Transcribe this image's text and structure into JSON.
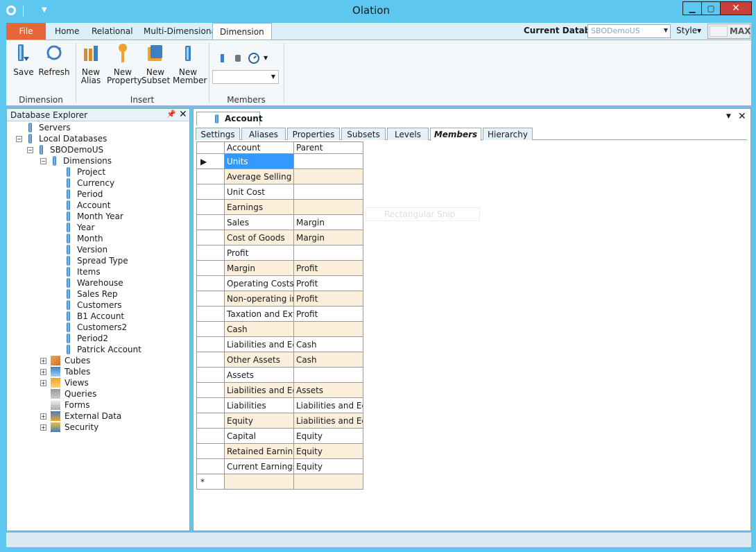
{
  "window": {
    "title": "Olation"
  },
  "ribbon_tabs": [
    "File",
    "Home",
    "Relational",
    "Multi-Dimensional",
    "Dimension"
  ],
  "current_db": {
    "label": "Current Database:",
    "value": "SBODemoUS"
  },
  "style": {
    "label": "Style",
    "max_label": "MAX"
  },
  "ribbon": {
    "save": "Save",
    "refresh": "Refresh",
    "dimension_group": "Dimension",
    "new_alias": [
      "New",
      "Alias"
    ],
    "new_property": [
      "New",
      "Property"
    ],
    "new_subset": [
      "New",
      "Subset"
    ],
    "new_member": [
      "New",
      "Member"
    ],
    "insert_group": "Insert",
    "members_group": "Members"
  },
  "explorer": {
    "title": "Database Explorer",
    "servers": "Servers",
    "local_databases": "Local Databases",
    "database": "SBODemoUS",
    "dimensions_label": "Dimensions",
    "dimensions": [
      "Project",
      "Currency",
      "Period",
      "Account",
      "Month Year",
      "Year",
      "Month",
      "Version",
      "Spread Type",
      "Items",
      "Warehouse",
      "Sales Rep",
      "Customers",
      "B1 Account",
      "Customers2",
      "Period2",
      "Patrick Account"
    ],
    "other": [
      "Cubes",
      "Tables",
      "Views",
      "Queries",
      "Forms",
      "External Data",
      "Security"
    ]
  },
  "document": {
    "tab": "Account",
    "subtabs": [
      "Settings",
      "Aliases",
      "Properties",
      "Subsets",
      "Levels",
      "Members",
      "Hierarchy"
    ],
    "columns": [
      "Account",
      "Parent"
    ],
    "rows": [
      [
        "Units",
        ""
      ],
      [
        "Average Selling ...",
        ""
      ],
      [
        "Unit Cost",
        ""
      ],
      [
        "Earnings",
        ""
      ],
      [
        "Sales",
        "Margin"
      ],
      [
        "Cost of Goods",
        "Margin"
      ],
      [
        "Profit",
        ""
      ],
      [
        "Margin",
        "Profit"
      ],
      [
        "Operating Costs",
        "Profit"
      ],
      [
        "Non-operating in...",
        "Profit"
      ],
      [
        "Taxation and Extr...",
        "Profit"
      ],
      [
        "Cash",
        ""
      ],
      [
        "Liabilities and Eq...",
        "Cash"
      ],
      [
        "Other Assets",
        "Cash"
      ],
      [
        "Assets",
        ""
      ],
      [
        "Liabilities and Eq...",
        "Assets"
      ],
      [
        "Liabilities",
        "Liabilities and Eq..."
      ],
      [
        "Equity",
        "Liabilities and Eq..."
      ],
      [
        "Capital",
        "Equity"
      ],
      [
        "Retained Earnings",
        "Equity"
      ],
      [
        "Current Earnings",
        "Equity"
      ]
    ],
    "new_row_marker": "*",
    "current_row_marker": "▶",
    "ghost_text": "Rectangular Snip"
  },
  "colors": {
    "titlebar": "#5ec7ef",
    "file_tab": "#e8653a",
    "selected_cell": "#3399ff",
    "alt_row": "#fbeedb",
    "close_button": "#c9403a"
  }
}
